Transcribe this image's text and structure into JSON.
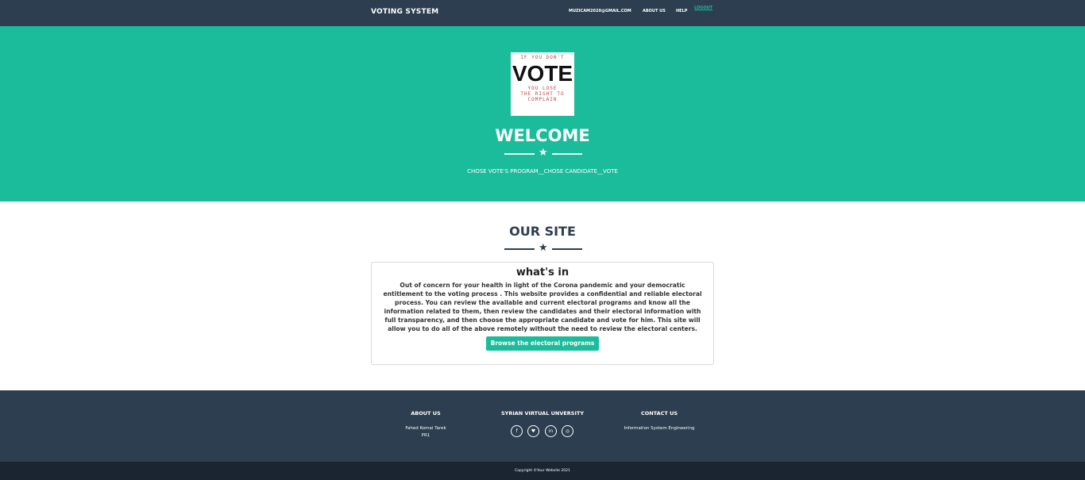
{
  "navbar": {
    "brand": "VOTING SYSTEM",
    "email": "MUZICAM2020@GMAIL.COM",
    "about": "ABOUT US",
    "help": "HELP",
    "logout": "LOGOUT"
  },
  "masthead": {
    "logo": {
      "line1": "IF YOU DON'T",
      "line2": "VOTE",
      "line3": "YOU LOSE",
      "line4": "THE RIGHT TO",
      "line5": "COMPLAIN"
    },
    "title": "WELCOME",
    "tagline": "CHOSE VOTE'S PROGRAM__CHOSE CANDIDATE__VOTE"
  },
  "about": {
    "title": "OUR SITE",
    "card_title": "what's in",
    "card_text": "Out of concern for your health in light of the Corona pandemic and your democratic entitlement to the voting process . This website provides a confidential and reliable electoral process. You can review the available and current electoral programs and know all the information related to them, then review the candidates and their electoral information with full transparency, and then choose the appropriate candidate and vote for him. This site will allow you to do all of the above remotely without the need to review the electoral centers.",
    "button": "Browse the electoral programs"
  },
  "footer": {
    "about_title": "ABOUT US",
    "about_name": "Fahed Komai Tarek",
    "about_sub": "PR1",
    "university_title": "SYRIAN VIRTUAL UNVERSITY",
    "social": [
      "facebook-icon",
      "twitter-icon",
      "linkedin-icon",
      "dribbble-icon"
    ],
    "contact_title": "CONTACT US",
    "contact_text": "Information System Engineering"
  },
  "copyright": "Copyright ©Your Website 2021",
  "colors": {
    "primary": "#2c3e50",
    "accent": "#1abc9c",
    "copyright_bg": "#1a252f"
  }
}
